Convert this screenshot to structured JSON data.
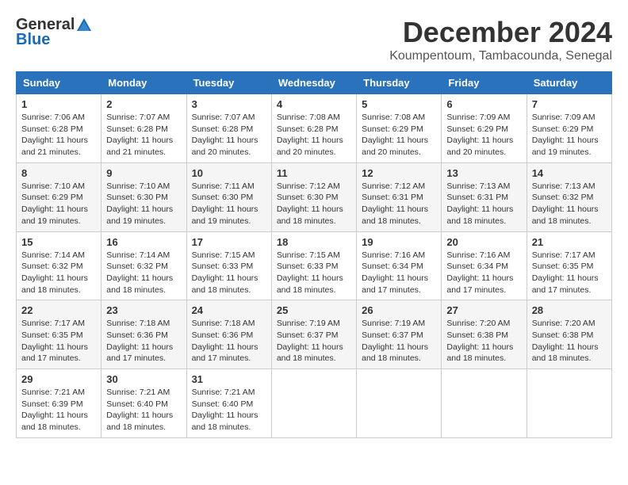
{
  "logo": {
    "general": "General",
    "blue": "Blue"
  },
  "title": {
    "month": "December 2024",
    "location": "Koumpentoum, Tambacounda, Senegal"
  },
  "headers": [
    "Sunday",
    "Monday",
    "Tuesday",
    "Wednesday",
    "Thursday",
    "Friday",
    "Saturday"
  ],
  "weeks": [
    [
      {
        "day": "1",
        "sunrise": "7:06 AM",
        "sunset": "6:28 PM",
        "daylight": "11 hours and 21 minutes."
      },
      {
        "day": "2",
        "sunrise": "7:07 AM",
        "sunset": "6:28 PM",
        "daylight": "11 hours and 21 minutes."
      },
      {
        "day": "3",
        "sunrise": "7:07 AM",
        "sunset": "6:28 PM",
        "daylight": "11 hours and 20 minutes."
      },
      {
        "day": "4",
        "sunrise": "7:08 AM",
        "sunset": "6:28 PM",
        "daylight": "11 hours and 20 minutes."
      },
      {
        "day": "5",
        "sunrise": "7:08 AM",
        "sunset": "6:29 PM",
        "daylight": "11 hours and 20 minutes."
      },
      {
        "day": "6",
        "sunrise": "7:09 AM",
        "sunset": "6:29 PM",
        "daylight": "11 hours and 20 minutes."
      },
      {
        "day": "7",
        "sunrise": "7:09 AM",
        "sunset": "6:29 PM",
        "daylight": "11 hours and 19 minutes."
      }
    ],
    [
      {
        "day": "8",
        "sunrise": "7:10 AM",
        "sunset": "6:29 PM",
        "daylight": "11 hours and 19 minutes."
      },
      {
        "day": "9",
        "sunrise": "7:10 AM",
        "sunset": "6:30 PM",
        "daylight": "11 hours and 19 minutes."
      },
      {
        "day": "10",
        "sunrise": "7:11 AM",
        "sunset": "6:30 PM",
        "daylight": "11 hours and 19 minutes."
      },
      {
        "day": "11",
        "sunrise": "7:12 AM",
        "sunset": "6:30 PM",
        "daylight": "11 hours and 18 minutes."
      },
      {
        "day": "12",
        "sunrise": "7:12 AM",
        "sunset": "6:31 PM",
        "daylight": "11 hours and 18 minutes."
      },
      {
        "day": "13",
        "sunrise": "7:13 AM",
        "sunset": "6:31 PM",
        "daylight": "11 hours and 18 minutes."
      },
      {
        "day": "14",
        "sunrise": "7:13 AM",
        "sunset": "6:32 PM",
        "daylight": "11 hours and 18 minutes."
      }
    ],
    [
      {
        "day": "15",
        "sunrise": "7:14 AM",
        "sunset": "6:32 PM",
        "daylight": "11 hours and 18 minutes."
      },
      {
        "day": "16",
        "sunrise": "7:14 AM",
        "sunset": "6:32 PM",
        "daylight": "11 hours and 18 minutes."
      },
      {
        "day": "17",
        "sunrise": "7:15 AM",
        "sunset": "6:33 PM",
        "daylight": "11 hours and 18 minutes."
      },
      {
        "day": "18",
        "sunrise": "7:15 AM",
        "sunset": "6:33 PM",
        "daylight": "11 hours and 18 minutes."
      },
      {
        "day": "19",
        "sunrise": "7:16 AM",
        "sunset": "6:34 PM",
        "daylight": "11 hours and 17 minutes."
      },
      {
        "day": "20",
        "sunrise": "7:16 AM",
        "sunset": "6:34 PM",
        "daylight": "11 hours and 17 minutes."
      },
      {
        "day": "21",
        "sunrise": "7:17 AM",
        "sunset": "6:35 PM",
        "daylight": "11 hours and 17 minutes."
      }
    ],
    [
      {
        "day": "22",
        "sunrise": "7:17 AM",
        "sunset": "6:35 PM",
        "daylight": "11 hours and 17 minutes."
      },
      {
        "day": "23",
        "sunrise": "7:18 AM",
        "sunset": "6:36 PM",
        "daylight": "11 hours and 17 minutes."
      },
      {
        "day": "24",
        "sunrise": "7:18 AM",
        "sunset": "6:36 PM",
        "daylight": "11 hours and 17 minutes."
      },
      {
        "day": "25",
        "sunrise": "7:19 AM",
        "sunset": "6:37 PM",
        "daylight": "11 hours and 18 minutes."
      },
      {
        "day": "26",
        "sunrise": "7:19 AM",
        "sunset": "6:37 PM",
        "daylight": "11 hours and 18 minutes."
      },
      {
        "day": "27",
        "sunrise": "7:20 AM",
        "sunset": "6:38 PM",
        "daylight": "11 hours and 18 minutes."
      },
      {
        "day": "28",
        "sunrise": "7:20 AM",
        "sunset": "6:38 PM",
        "daylight": "11 hours and 18 minutes."
      }
    ],
    [
      {
        "day": "29",
        "sunrise": "7:21 AM",
        "sunset": "6:39 PM",
        "daylight": "11 hours and 18 minutes."
      },
      {
        "day": "30",
        "sunrise": "7:21 AM",
        "sunset": "6:40 PM",
        "daylight": "11 hours and 18 minutes."
      },
      {
        "day": "31",
        "sunrise": "7:21 AM",
        "sunset": "6:40 PM",
        "daylight": "11 hours and 18 minutes."
      },
      null,
      null,
      null,
      null
    ]
  ],
  "labels": {
    "sunrise": "Sunrise:",
    "sunset": "Sunset:",
    "daylight": "Daylight:"
  }
}
